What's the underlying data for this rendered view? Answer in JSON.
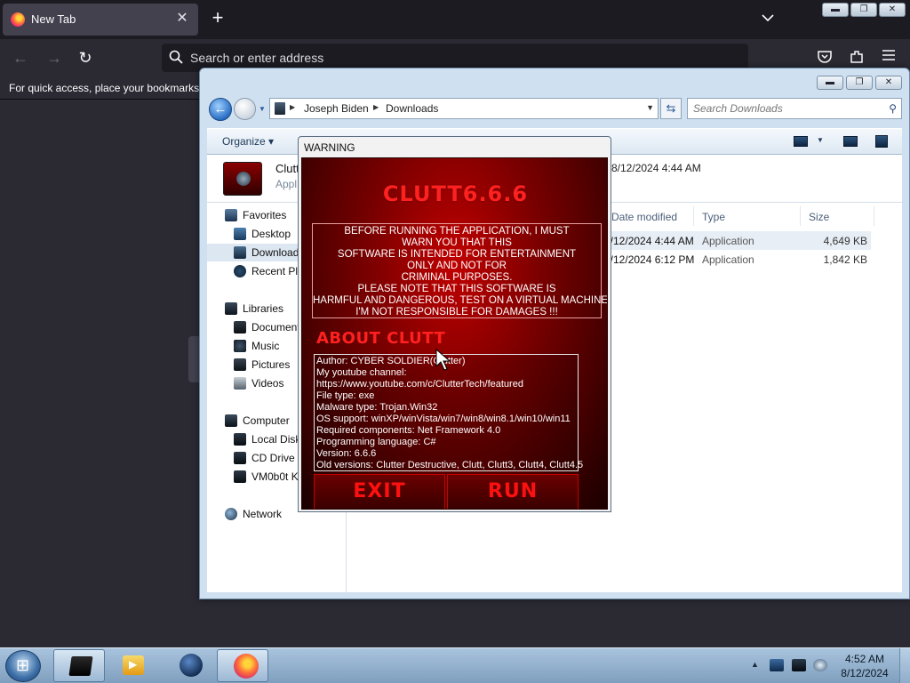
{
  "browser": {
    "tab_title": "New Tab",
    "tab_close": "✕",
    "new_tab": "+",
    "url_placeholder": "Search or enter address",
    "bookmarks_hint": "For quick access, place your bookmarks here on the bookmarks toolbar."
  },
  "explorer": {
    "breadcrumb": [
      "Joseph Biden",
      "Downloads"
    ],
    "search_placeholder": "Search Downloads",
    "organize_label": "Organize ▾",
    "details": {
      "name": "Clutt",
      "type": "Appl",
      "date": "8/12/2024 4:44 AM"
    },
    "nav": {
      "favorites": "Favorites",
      "desktop": "Desktop",
      "downloads": "Downloads",
      "recent": "Recent Places",
      "libraries": "Libraries",
      "documents": "Documents",
      "music": "Music",
      "pictures": "Pictures",
      "videos": "Videos",
      "computer": "Computer",
      "local_disk": "Local Disk",
      "cd_drive": "CD Drive",
      "vm": "VM0b0t K",
      "network": "Network"
    },
    "columns": {
      "modified": "Date modified",
      "type": "Type",
      "size": "Size"
    },
    "rows": [
      {
        "modified": "8/12/2024 4:44 AM",
        "type": "Application",
        "size": "4,649 KB"
      },
      {
        "modified": "8/12/2024 6:12 PM",
        "type": "Application",
        "size": "1,842 KB"
      }
    ]
  },
  "dialog": {
    "title": "WARNING",
    "heading": "CLUTT6.6.6",
    "warning_lines": [
      "BEFORE RUNNING THE APPLICATION, I MUST",
      "WARN YOU THAT THIS",
      "SOFTWARE IS INTENDED FOR ENTERTAINMENT",
      "ONLY AND NOT FOR",
      "CRIMINAL PURPOSES.",
      "PLEASE NOTE THAT THIS SOFTWARE IS",
      "HARMFUL AND DANGEROUS, TEST ON A VIRTUAL MACHINE!",
      "I'M NOT RESPONSIBLE FOR DAMAGES !!!"
    ],
    "about_heading": "ABOUT CLUTT",
    "about_lines": [
      "Author: CYBER SOLDIER(Clutter)",
      "My youtube channel:",
      "https://www.youtube.com/c/ClutterTech/featured",
      "File type: exe",
      "Malware type: Trojan.Win32",
      "OS support: winXP/winVista/win7/win8/win8.1/win10/win11",
      "Required components: Net Framework 4.0",
      "Programming language: C#",
      "Version: 6.6.6",
      "Old versions: Clutter Destructive, Clutt, Clutt3, Clutt4, Clutt4.5"
    ],
    "exit_label": "EXIT",
    "run_label": "RUN"
  },
  "taskbar": {
    "time": "4:52 AM",
    "date": "8/12/2024"
  },
  "colors": {
    "dialog_red": "#ff2020",
    "dialog_bg": "#7a0000",
    "firefox_dark": "#2b2a33",
    "taskbar": "#a9c3dd"
  }
}
